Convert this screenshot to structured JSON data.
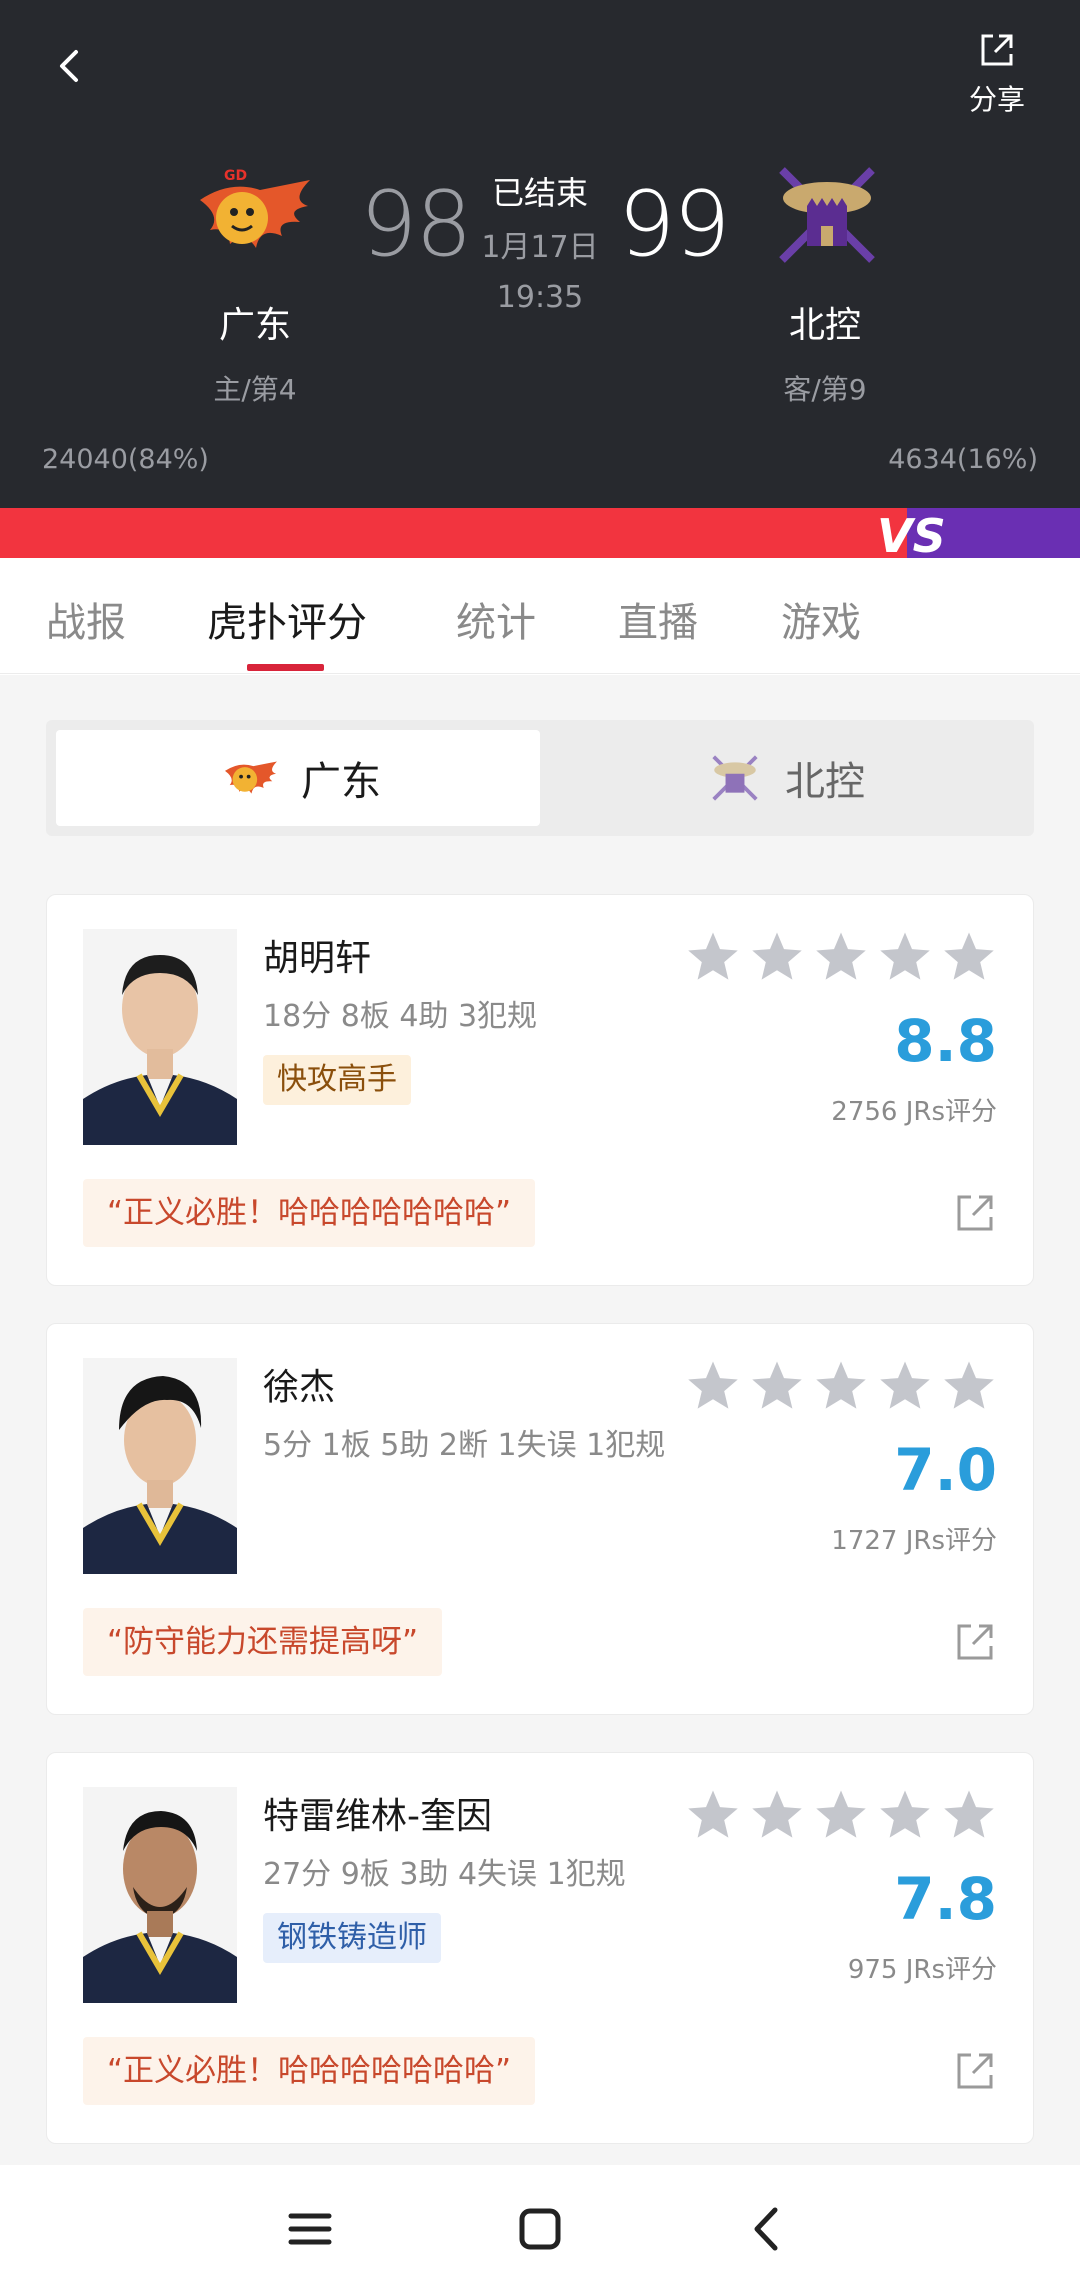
{
  "header": {
    "share_label": "分享",
    "status": "已结束",
    "date": "1月17日",
    "time": "19:35",
    "home": {
      "name": "广东",
      "rank": "主/第4",
      "score": "98",
      "support": "24040(84%)"
    },
    "away": {
      "name": "北控",
      "rank": "客/第9",
      "score": "99",
      "support": "4634(16%)"
    },
    "vs_text": "VS",
    "home_support_fraction": 0.84
  },
  "tabs": [
    "战报",
    "虎扑评分",
    "统计",
    "直播",
    "游戏"
  ],
  "active_tab": 1,
  "team_toggle": {
    "left": "广东",
    "right": "北控",
    "selected": "广东"
  },
  "players": [
    {
      "name": "胡明轩",
      "stats": "18分 8板 4助 3犯规",
      "tag": "快攻高手",
      "tag_style": "gold",
      "rating": "8.8",
      "votes": "2756 JRs评分",
      "comment": "“正义必胜！哈哈哈哈哈哈哈”"
    },
    {
      "name": "徐杰",
      "stats": "5分 1板 5助 2断 1失误 1犯规",
      "tag": "",
      "tag_style": "",
      "rating": "7.0",
      "votes": "1727 JRs评分",
      "comment": "“防守能力还需提高呀”"
    },
    {
      "name": "特雷维林-奎因",
      "stats": "27分 9板 3助 4失误 1犯规",
      "tag": "钢铁铸造师",
      "tag_style": "blue",
      "rating": "7.8",
      "votes": "975 JRs评分",
      "comment": "“正义必胜！哈哈哈哈哈哈哈”"
    }
  ],
  "colors": {
    "header_bg": "#27292e",
    "home_red": "#f2343f",
    "away_purple": "#6a2fb3",
    "accent_red": "#d8243a",
    "rating_blue": "#2a9ddb"
  }
}
